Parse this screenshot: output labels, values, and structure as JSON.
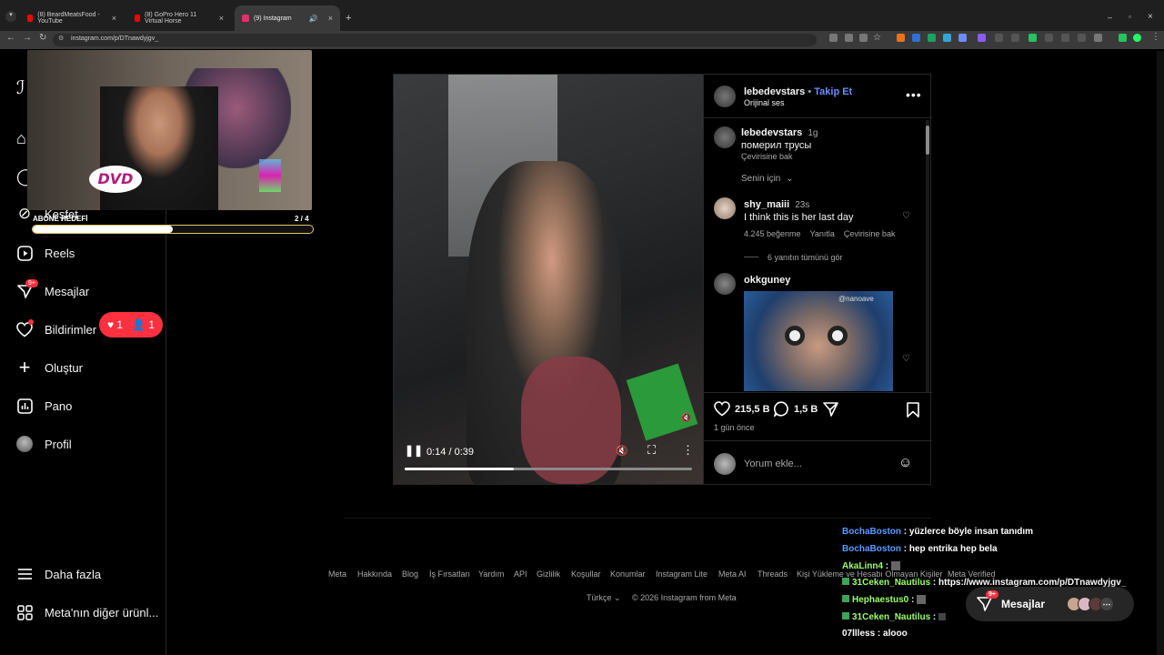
{
  "browser": {
    "tabs": [
      {
        "title": "(8) BeardMeatsFood - YouTube",
        "color": "#ff0000"
      },
      {
        "title": "(8) GoPro Hero 11 Virtual Horse",
        "color": "#ff0000"
      },
      {
        "title": "(9) Instagram",
        "color": "#e1306c"
      }
    ],
    "url": "instagram.com/p/DTnawdyjgv_"
  },
  "sidebar": {
    "items": [
      {
        "label": "Keşfet",
        "icon": "compass-icon"
      },
      {
        "label": "Reels",
        "icon": "reels-icon"
      },
      {
        "label": "Mesajlar",
        "icon": "messenger-icon"
      },
      {
        "label": "Bildirimler",
        "icon": "heart-icon"
      },
      {
        "label": "Oluştur",
        "icon": "plus-icon"
      },
      {
        "label": "Pano",
        "icon": "dashboard-icon"
      },
      {
        "label": "Profil",
        "icon": "profile-avatar"
      }
    ],
    "more": "Daha fazla",
    "meta": "Meta'nın diğer ürünl...",
    "messages_badge": "9+",
    "notif_pill": {
      "likes": "1",
      "follows": "1"
    }
  },
  "overlay": {
    "dvd_logo": "DVD",
    "goal_label": "ABONE HEDEFİ",
    "goal_count": "2 / 4",
    "goal_progress": 0.5
  },
  "video": {
    "time": "0:14 / 0:39",
    "progress": 0.38
  },
  "post": {
    "author": "lebedevstars",
    "follow": "Takip Et",
    "audio": "Orijinal ses",
    "caption": {
      "user": "lebedevstars",
      "time": "1g",
      "text": "померил трусы",
      "translate": "Çevirisine bak"
    },
    "sort": "Senin için",
    "comments": [
      {
        "user": "shy_maiii",
        "time": "23s",
        "text": "I think this is her last day",
        "likes": "4.245 beğenme",
        "reply": "Yanıtla",
        "translate": "Çevirisine bak",
        "view_replies": "6 yanıtın tümünü gör"
      },
      {
        "user": "okkguney",
        "image_watermark": "@nanoave"
      }
    ],
    "likes": "215,5 B",
    "comment_count": "1,5 B",
    "posted": "1 gün önce",
    "comment_placeholder": "Yorum ekle..."
  },
  "footer": {
    "links": [
      "Meta",
      "Hakkında",
      "Blog",
      "İş Fırsatları",
      "Yardım",
      "API",
      "Gizlilik",
      "Koşullar",
      "Konumlar",
      "Instagram Lite",
      "Meta AI",
      "Threads",
      "Kişi Yükleme ve Hesabı Olmayan Kişiler",
      "Meta Verified"
    ],
    "language": "Türkçe",
    "copyright": "© 2026 Instagram from Meta"
  },
  "chat": [
    {
      "user": "BochaBoston",
      "message": "yüzlerce böyle insan tanıdım",
      "color": "#5b9bff"
    },
    {
      "user": "BochaBoston",
      "message": "hep entrika hep bela",
      "color": "#5b9bff"
    },
    {
      "user": "AkaLinn4",
      "message": "",
      "color": "#9cff6b"
    },
    {
      "user": "31Ceken_Nautilus",
      "message": "https://www.instagram.com/p/DTnawdyjgv_",
      "color": "#9cff6b"
    },
    {
      "user": "Hephaestus0",
      "message": "",
      "color": "#9cff6b"
    },
    {
      "user": "31Ceken_Nautilus",
      "message": "",
      "color": "#9cff6b"
    },
    {
      "user": "07llless",
      "message": "alooo",
      "color": "#ffffff"
    }
  ],
  "dm_pill": {
    "label": "Mesajlar",
    "badge": "9+"
  }
}
